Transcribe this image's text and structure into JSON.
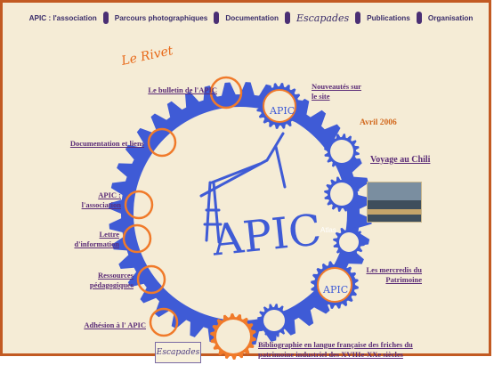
{
  "nav": {
    "association": "APIC : l'association",
    "parcours": "Parcours photographiques",
    "documentation": "Documentation",
    "escapades": "Escapades",
    "publications": "Publications",
    "organisation": "Organisation"
  },
  "logo_title": "Le Rivet",
  "center_word": "APIC",
  "links": {
    "bulletin": "Le bulletin de l'APIC",
    "nouveautes": "Nouveautés sur le site",
    "doc_liens": "Documentation et liens",
    "assoc": "APIC : l'association",
    "lettre": "Lettre d'information",
    "ressources": "Ressources pédagogiques",
    "adhesion": "Adhésion à l' APIC",
    "mercredis": "Les mercredis du Patrimoine",
    "bibliographie": "Bibliographie en langue française des friches du patrimoine industriel des XVIIIe-XXe siècles"
  },
  "news": {
    "date": "Avril 2006",
    "voyage": "Voyage au Chili",
    "atlas": "Atlas"
  },
  "escapades_button": "Escapades",
  "colors": {
    "frame": "#c25a22",
    "background": "#f5ecd6",
    "gear_blue": "#3f5bd6",
    "ring_orange": "#f07a2a",
    "link_purple": "#5b2c77"
  }
}
